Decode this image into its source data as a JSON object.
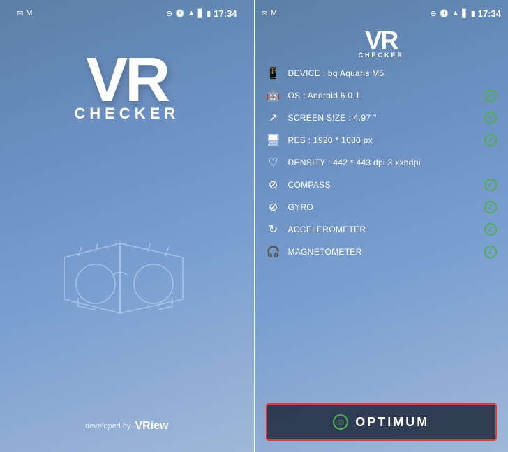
{
  "left": {
    "statusBar": {
      "time": "17:34",
      "icons": [
        "msg",
        "gmail",
        "minus-circle",
        "clock",
        "wifi",
        "signal",
        "battery"
      ]
    },
    "vrLogo": "VR",
    "checkerLabel": "CHECKER",
    "cardboardAlt": "VR Cardboard illustration",
    "developedBy": "developed by",
    "vriewLogo": "VRiew"
  },
  "right": {
    "statusBar": {
      "time": "17:34",
      "icons": [
        "msg",
        "gmail",
        "minus-circle",
        "clock",
        "wifi",
        "signal",
        "battery"
      ]
    },
    "vrLogo": "VR",
    "checkerLabel": "CHECKER",
    "specs": [
      {
        "id": "device",
        "iconUnicode": "📱",
        "text": "DEVICE : bq Aquaris M5",
        "hasCheck": false
      },
      {
        "id": "os",
        "iconUnicode": "🤖",
        "text": "OS : Android 6.0.1",
        "hasCheck": true
      },
      {
        "id": "screen",
        "iconUnicode": "📐",
        "text": "SCREEN SIZE : 4.97 \"",
        "hasCheck": true
      },
      {
        "id": "res",
        "iconUnicode": "🖥",
        "text": "RES : 1920 * 1080 px",
        "hasCheck": true
      },
      {
        "id": "density",
        "iconUnicode": "❤",
        "text": "DENSITY : 442 * 443 dpi 3 xxhdpi",
        "hasCheck": false
      },
      {
        "id": "compass",
        "iconUnicode": "🧭",
        "text": "COMPASS",
        "hasCheck": true
      },
      {
        "id": "gyro",
        "iconUnicode": "🧭",
        "text": "GYRO",
        "hasCheck": true
      },
      {
        "id": "accelerometer",
        "iconUnicode": "🔄",
        "text": "ACCELEROMETER",
        "hasCheck": true
      },
      {
        "id": "magnetometer",
        "iconUnicode": "🎧",
        "text": "MAGNETOMETER",
        "hasCheck": true
      }
    ],
    "optimumButton": {
      "label": "OPTIMUM",
      "smile": "☺"
    }
  }
}
